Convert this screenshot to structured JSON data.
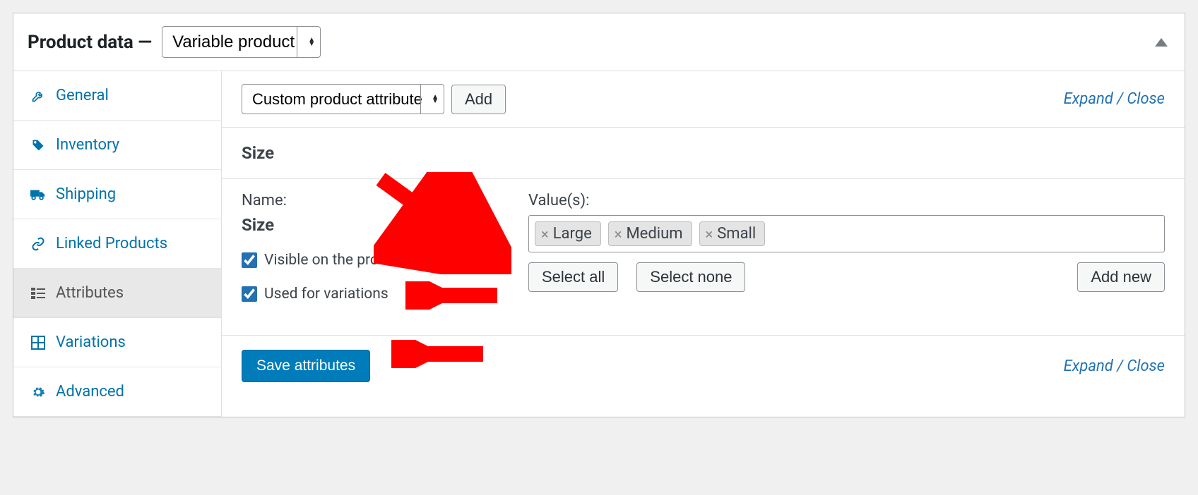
{
  "header": {
    "title": "Product data —",
    "product_type": "Variable product"
  },
  "tabs": [
    {
      "key": "general",
      "label": "General",
      "icon": "wrench"
    },
    {
      "key": "inventory",
      "label": "Inventory",
      "icon": "tag"
    },
    {
      "key": "shipping",
      "label": "Shipping",
      "icon": "truck"
    },
    {
      "key": "linked",
      "label": "Linked Products",
      "icon": "link"
    },
    {
      "key": "attributes",
      "label": "Attributes",
      "icon": "list",
      "active": true
    },
    {
      "key": "variations",
      "label": "Variations",
      "icon": "grid"
    },
    {
      "key": "advanced",
      "label": "Advanced",
      "icon": "gear"
    }
  ],
  "toolbar": {
    "attribute_select": "Custom product attribute",
    "add": "Add",
    "expand": "Expand",
    "close": "Close"
  },
  "attribute": {
    "title": "Size",
    "name_label": "Name:",
    "name_value": "Size",
    "visible_label": "Visible on the product page",
    "visible_checked": true,
    "variations_label": "Used for variations",
    "variations_checked": true,
    "values_label": "Value(s):",
    "values": [
      "Large",
      "Medium",
      "Small"
    ],
    "buttons": {
      "select_all": "Select all",
      "select_none": "Select none",
      "add_new": "Add new"
    }
  },
  "footer": {
    "save": "Save attributes",
    "expand": "Expand",
    "close": "Close"
  }
}
